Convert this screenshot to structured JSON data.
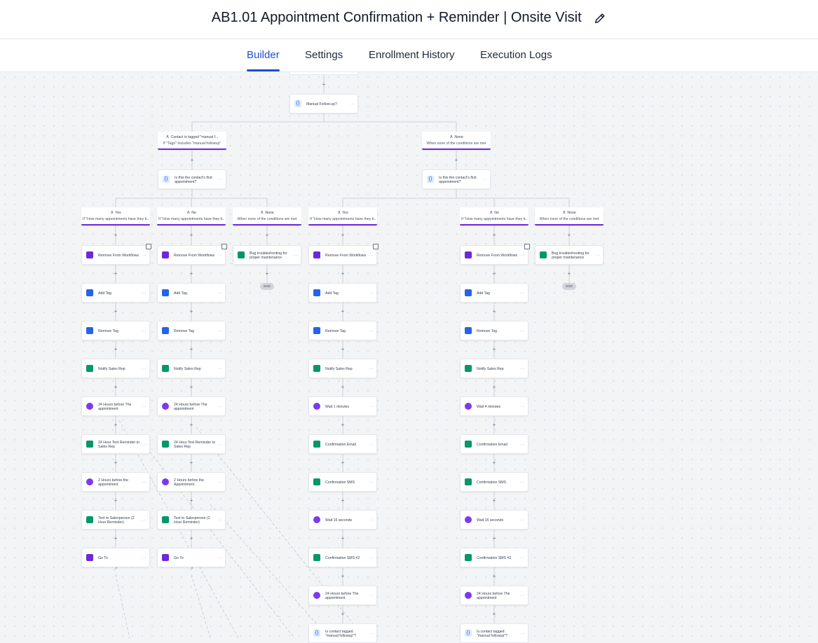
{
  "header": {
    "title": "AB1.01 Appointment Confirmation + Reminder | Onsite Visit",
    "edit_icon": "pencil-icon"
  },
  "tabs": [
    {
      "label": "Builder",
      "active": true
    },
    {
      "label": "Settings",
      "active": false
    },
    {
      "label": "Enrollment History",
      "active": false
    },
    {
      "label": "Execution Logs",
      "active": false
    }
  ],
  "colors": {
    "accent": "#1d4ed8",
    "branch_accent": "#6d28d9",
    "icon_blue": "#2563eb",
    "icon_green": "#059669",
    "icon_purple": "#7c3aed",
    "icon_action": "#6d28d9"
  },
  "canvas": {
    "root_condition": {
      "label": "Manual Follow-up?",
      "icon": "braces-icon"
    },
    "level1_branches": [
      {
        "title": "Contact is tagged \"manual f...",
        "subtitle": "If \"Tags\" Includes \"manual followup\""
      },
      {
        "title": "None",
        "subtitle": "When none of the conditions are met"
      }
    ],
    "level2_conditions": [
      {
        "label": "Is this the contact's first appointment?",
        "icon": "braces-icon"
      },
      {
        "label": "Is this the contact's first appointment?",
        "icon": "braces-icon"
      }
    ],
    "columns": [
      {
        "branch": {
          "title": "Yes",
          "subtitle": "If \"How many appointments have they b..."
        },
        "actions": [
          {
            "label": "Remove From Workflows",
            "icon": "workflow-remove-icon"
          },
          {
            "label": "Add Tag",
            "icon": "tag-icon"
          },
          {
            "label": "Remove Tag",
            "icon": "tag-remove-icon"
          },
          {
            "label": "Notify Sales Rep",
            "icon": "bell-icon"
          },
          {
            "label": "24 Hours before The appointment",
            "icon": "clock-icon"
          },
          {
            "label": "24 Hour Text Reminder to Sales Rep",
            "icon": "bell-icon"
          },
          {
            "label": "2 Hours before the appointment",
            "icon": "clock-icon"
          },
          {
            "label": "Text to Salesperson (2 Hour Reminder)",
            "icon": "bell-icon"
          },
          {
            "label": "Go To",
            "icon": "goto-icon"
          }
        ]
      },
      {
        "branch": {
          "title": "No",
          "subtitle": "If \"How many appointments have they b..."
        },
        "actions": [
          {
            "label": "Remove From Workflows",
            "icon": "workflow-remove-icon"
          },
          {
            "label": "Add Tag",
            "icon": "tag-icon"
          },
          {
            "label": "Remove Tag",
            "icon": "tag-remove-icon"
          },
          {
            "label": "Notify Sales Rep",
            "icon": "bell-icon"
          },
          {
            "label": "24 Hours before The appointment",
            "icon": "clock-icon"
          },
          {
            "label": "24 Hour Text Reminder to Sales Rep",
            "icon": "bell-icon"
          },
          {
            "label": "2 Hours before the Appointment",
            "icon": "clock-icon"
          },
          {
            "label": "Text to Salesperson (2 Hour Reminder)",
            "icon": "bell-icon"
          },
          {
            "label": "Go To",
            "icon": "goto-icon"
          }
        ]
      },
      {
        "branch": {
          "title": "None",
          "subtitle": "When none of the conditions are met"
        },
        "actions": [
          {
            "label": "Bug troubleshooting for proper maintenance",
            "icon": "bell-icon"
          }
        ],
        "end_label": "END"
      },
      {
        "branch": {
          "title": "Yes",
          "subtitle": "If \"How many appointments have they b..."
        },
        "actions": [
          {
            "label": "Remove From Workflows",
            "icon": "workflow-remove-icon"
          },
          {
            "label": "Add Tag",
            "icon": "tag-icon"
          },
          {
            "label": "Remove Tag",
            "icon": "tag-remove-icon"
          },
          {
            "label": "Notify Sales Rep",
            "icon": "bell-icon"
          },
          {
            "label": "Wait 1 minutes",
            "icon": "clock-icon"
          },
          {
            "label": "Confirmation Email",
            "icon": "email-icon"
          },
          {
            "label": "Confirmation SMS",
            "icon": "sms-icon"
          },
          {
            "label": "Wait 15 seconds",
            "icon": "clock-icon"
          },
          {
            "label": "Confirmation SMS #2",
            "icon": "sms-icon"
          },
          {
            "label": "24 Hours before The appointment",
            "icon": "clock-icon"
          },
          {
            "label": "Is contact tagged \"manual followup\"?",
            "icon": "braces-icon"
          }
        ]
      },
      {
        "branch": {
          "title": "No",
          "subtitle": "If \"How many appointments have they b..."
        },
        "actions": [
          {
            "label": "Remove From Workflows",
            "icon": "workflow-remove-icon"
          },
          {
            "label": "Add Tag",
            "icon": "tag-icon"
          },
          {
            "label": "Remove Tag",
            "icon": "tag-remove-icon"
          },
          {
            "label": "Notify Sales Rep",
            "icon": "bell-icon"
          },
          {
            "label": "Wait 4 minutes",
            "icon": "clock-icon"
          },
          {
            "label": "Confirmation Email",
            "icon": "email-icon"
          },
          {
            "label": "Confirmation SMS",
            "icon": "sms-icon"
          },
          {
            "label": "Wait 15 seconds",
            "icon": "clock-icon"
          },
          {
            "label": "Confirmation SMS #2",
            "icon": "sms-icon"
          },
          {
            "label": "24 Hours before The appointment",
            "icon": "clock-icon"
          },
          {
            "label": "Is contact tagged \"manual followup\"?",
            "icon": "braces-icon"
          }
        ]
      },
      {
        "branch": {
          "title": "None",
          "subtitle": "When none of the conditions are met"
        },
        "actions": [
          {
            "label": "Bug troubleshooting for proper maintenance",
            "icon": "bell-icon"
          }
        ],
        "end_label": "END"
      }
    ]
  }
}
